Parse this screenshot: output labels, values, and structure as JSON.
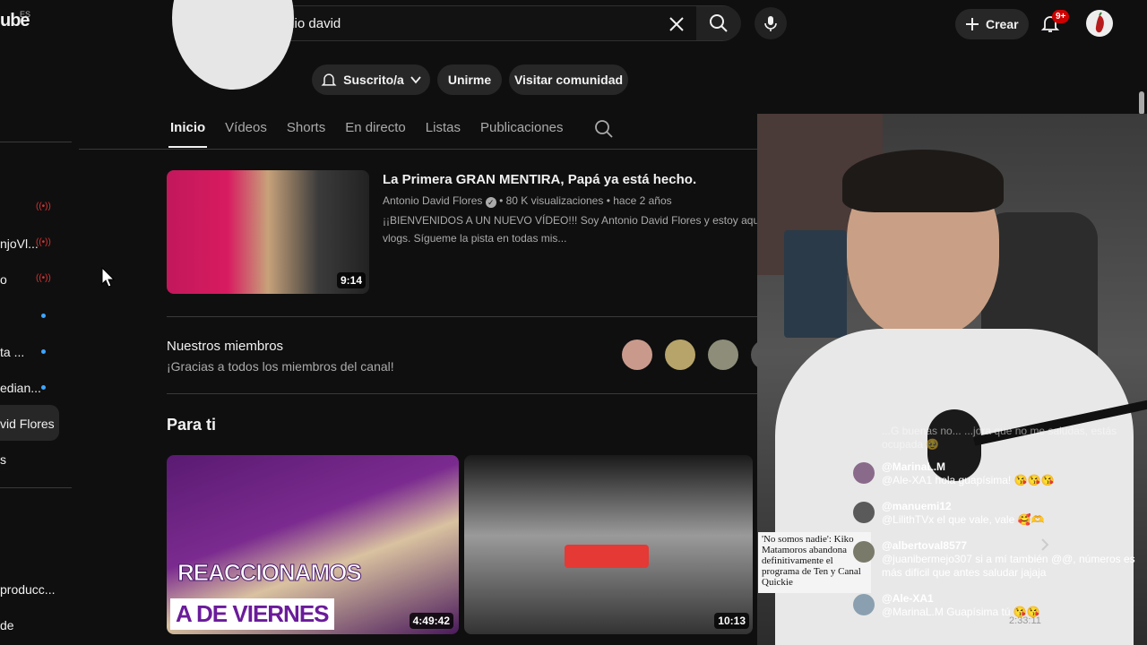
{
  "topbar": {
    "logo_text": "ube",
    "logo_region": "ES",
    "search_value": "antonio david",
    "create_label": "Crear",
    "notifications_badge": "9+"
  },
  "sidebar": {
    "items": [
      {
        "label": "njoVl..."
      },
      {
        "label": "o"
      },
      {
        "label": "ta ..."
      },
      {
        "label": "edian..."
      },
      {
        "label": "vid Flores"
      },
      {
        "label": "s"
      },
      {
        "label": "producc..."
      },
      {
        "label": "de"
      }
    ]
  },
  "channel": {
    "subscribed_label": "Suscrito/a",
    "join_label": "Unirme",
    "community_label": "Visitar comunidad",
    "tabs": [
      "Inicio",
      "Vídeos",
      "Shorts",
      "En directo",
      "Listas",
      "Publicaciones"
    ]
  },
  "featured": {
    "title": "La Primera GRAN MENTIRA, Papá ya está hecho.",
    "channel": "Antonio David Flores",
    "views": "80 K visualizaciones",
    "age": "hace 2 años",
    "desc_line1": "¡¡BIENVENIDOS A UN NUEVO VÍDEO!!! Soy Antonio David Flores y estoy aquí en mi car",
    "desc_line2": "vlogs. Sígueme la pista en todas mis...",
    "duration": "9:14"
  },
  "members": {
    "title": "Nuestros miembros",
    "subtitle": "¡Gracias a todos los miembros del canal!"
  },
  "for_you": {
    "title": "Para ti",
    "videos": [
      {
        "overlay_line1": "REACCIONAMOS",
        "overlay_line2": "A DE VIERNES",
        "duration": "4:49:42"
      },
      {
        "duration": "10:13"
      }
    ]
  },
  "overlay": {
    "news_card": "'No somos nadie': Kiko Matamoros abandona definitivamente el programa de Ten y Canal Quickie",
    "chat": [
      {
        "user": "",
        "text": "...G buenas no... ...jora que no me saludas, estás ocupada 🥹"
      },
      {
        "user": "@MarinaL.M",
        "text": "@Ale-XA1 hola guapísima! 😘😘😘"
      },
      {
        "user": "@manuemi12",
        "text": "@LilithTVx el que vale, vale 🥰🫶"
      },
      {
        "user": "@albertoval8577",
        "text": "@juanibermejo307 si a mí también @@, números es más difícil que antes saludar jajaja"
      },
      {
        "user": "@Ale-XA1",
        "text": "@MarinaL.M Guapísima tú 😘😘"
      }
    ],
    "timestamp": "2:33:11"
  }
}
